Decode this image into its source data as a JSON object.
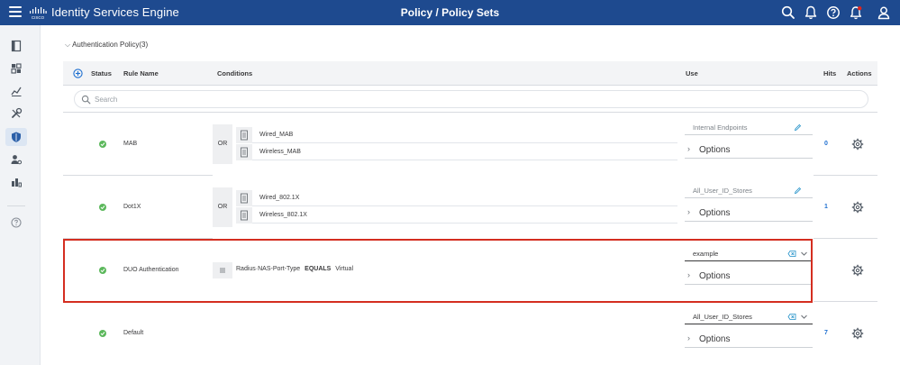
{
  "header": {
    "app_title": "Identity Services Engine",
    "page_title": "Policy / Policy Sets",
    "icons": [
      "menu-icon",
      "cisco-logo",
      "search-icon",
      "bell-icon",
      "help-icon",
      "notification-icon",
      "user-icon"
    ]
  },
  "section": {
    "title": "Authentication Policy(3)"
  },
  "table": {
    "columns": {
      "status": "Status",
      "rule_name": "Rule Name",
      "conditions": "Conditions",
      "use": "Use",
      "hits": "Hits",
      "actions": "Actions"
    },
    "search_placeholder": "Search",
    "rows": [
      {
        "status": "enabled",
        "name": "MAB",
        "operator": "OR",
        "conditions": [
          "Wired_MAB",
          "Wireless_MAB"
        ],
        "use": "Internal Endpoints",
        "options": "Options",
        "hits": "0"
      },
      {
        "status": "enabled",
        "name": "Dot1X",
        "operator": "OR",
        "conditions": [
          "Wired_802.1X",
          "Wireless_802.1X"
        ],
        "use": "All_User_ID_Stores",
        "options": "Options",
        "hits": "1"
      },
      {
        "status": "enabled",
        "name": "DUO Authentication",
        "condition_attr": "Radius·NAS-Port-Type",
        "condition_op": "EQUALS",
        "condition_val": "Virtual",
        "use": "example",
        "options": "Options",
        "hits": ""
      },
      {
        "status": "enabled",
        "name": "Default",
        "use": "All_User_ID_Stores",
        "options": "Options",
        "hits": "7"
      }
    ]
  },
  "colors": {
    "header_bg": "#1e4a8f",
    "status_green": "#5cb85c",
    "highlight_red": "#d42e20",
    "link_blue": "#1e6fd0"
  }
}
